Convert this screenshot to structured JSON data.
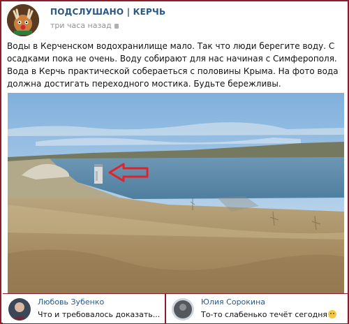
{
  "post": {
    "group_name": "ПОДСЛУШАНО | КЕРЧЬ",
    "time": "три часа назад",
    "text": "Воды в Керченском водохранилище мало. Так что люди берегите воду. С осадками пока не очень. Воду собирают для нас начиная с Симферополя. Вода в Керчь практической собераеться с половины Крыма. На фото вода должна достигать переходного мостика. Будьте бережливы."
  },
  "comments": [
    {
      "author": "Любовь Зубенко",
      "text": "Что и требовалось доказать..."
    },
    {
      "author": "Юлия Сорокина",
      "text": "То-то слабенько течёт сегодня"
    }
  ],
  "colors": {
    "frame": "#8b1e2a",
    "link": "#2a5885",
    "arrow": "#e0222a"
  }
}
